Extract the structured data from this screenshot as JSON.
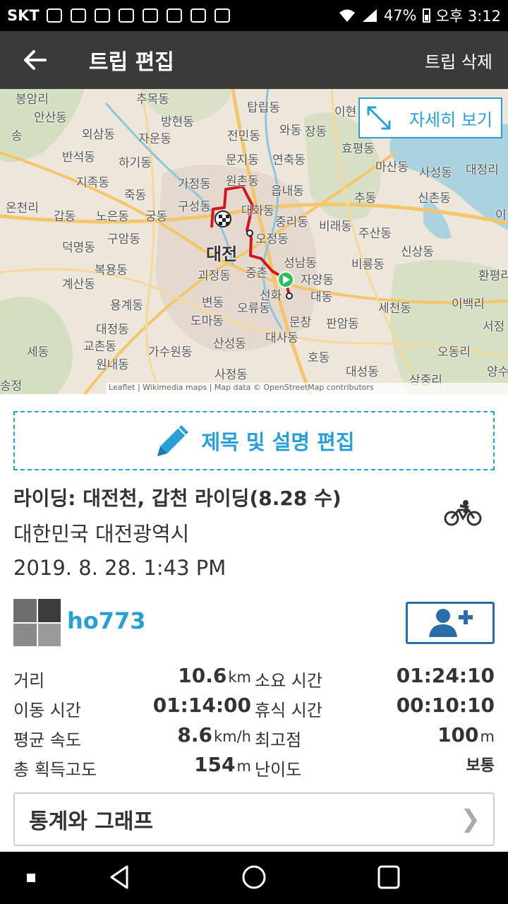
{
  "status_bar": {
    "carrier": "SKT",
    "battery": "47%",
    "time": "오후 3:12"
  },
  "app_bar": {
    "title": "트립 편집",
    "delete_label": "트립 삭제"
  },
  "map": {
    "detail_label": "자세히 보기",
    "city_label": "대전",
    "attribution": "Leaflet | Wikimedia maps | Map data © OpenStreetMap contributors",
    "places": [
      "봉암리",
      "추목동",
      "이현",
      "안산동",
      "탑립동",
      "방현동",
      "와동",
      "장동",
      "외삼동",
      "송",
      "자운동",
      "전민동",
      "효평동",
      "반석동",
      "하기동",
      "문지동",
      "연축동",
      "마산동",
      "사성동",
      "대정리",
      "지족동",
      "가정동",
      "원촌동",
      "읍내동",
      "추동",
      "신촌동",
      "온천리",
      "죽동",
      "구성동",
      "대화동",
      "갑동",
      "노은동",
      "궁동",
      "중리동",
      "비래동",
      "주산동",
      "이",
      "구암동",
      "오정동",
      "덕명동",
      "성남동",
      "신상동",
      "복용동",
      "괴정동",
      "중촌",
      "자양동",
      "비룡동",
      "환평리",
      "계산동",
      "선화",
      "대동",
      "세천동",
      "이백리",
      "용계동",
      "변동",
      "오류동",
      "서정",
      "도마동",
      "문창",
      "판암동",
      "대정동",
      "대사동",
      "교촌동",
      "오동리",
      "세동",
      "가수원동",
      "산성동",
      "호동",
      "양수",
      "원내동",
      "대성동",
      "상중리",
      "송정",
      "사정동"
    ]
  },
  "edit_title_label": "제목 및 설명 편집",
  "trip": {
    "title": "라이딩: 대전천, 갑천 라이딩(8.28 수)",
    "location": "대한민국 대전광역시",
    "datetime": "2019. 8. 28. 1:43 PM"
  },
  "user": {
    "name": "ho773"
  },
  "stats": {
    "distance": {
      "label": "거리",
      "value": "10.6",
      "unit": "km"
    },
    "elapsed": {
      "label": "소요 시간",
      "value": "01:24:10"
    },
    "moving": {
      "label": "이동 시간",
      "value": "01:14:00"
    },
    "rest": {
      "label": "휴식 시간",
      "value": "00:10:10"
    },
    "avg_speed": {
      "label": "평균 속도",
      "value": "8.6",
      "unit": "km/h"
    },
    "max_elev": {
      "label": "최고점",
      "value": "100",
      "unit": "m"
    },
    "elev_gain": {
      "label": "총 획득고도",
      "value": "154",
      "unit": "m"
    },
    "difficulty": {
      "label": "난이도",
      "value": "보통"
    }
  },
  "graph_button_label": "통계와 그래프",
  "colors": {
    "accent": "#2a9fd6",
    "route": "#d0191e",
    "appbar": "#3a3a3a"
  }
}
